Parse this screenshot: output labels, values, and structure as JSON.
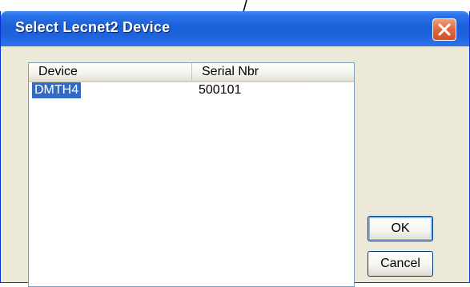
{
  "dialog": {
    "title": "Select Lecnet2 Device",
    "close_icon": "close-icon"
  },
  "list": {
    "columns": [
      "Device",
      "Serial Nbr"
    ],
    "rows": [
      {
        "device": "DMTH4",
        "serial": "500101",
        "selected": true
      }
    ]
  },
  "buttons": {
    "ok": "OK",
    "cancel": "Cancel"
  },
  "colors": {
    "titlebar": "#1f63dc",
    "selection": "#316ac5",
    "close_button": "#e1663f",
    "window_face": "#ece9d8"
  }
}
